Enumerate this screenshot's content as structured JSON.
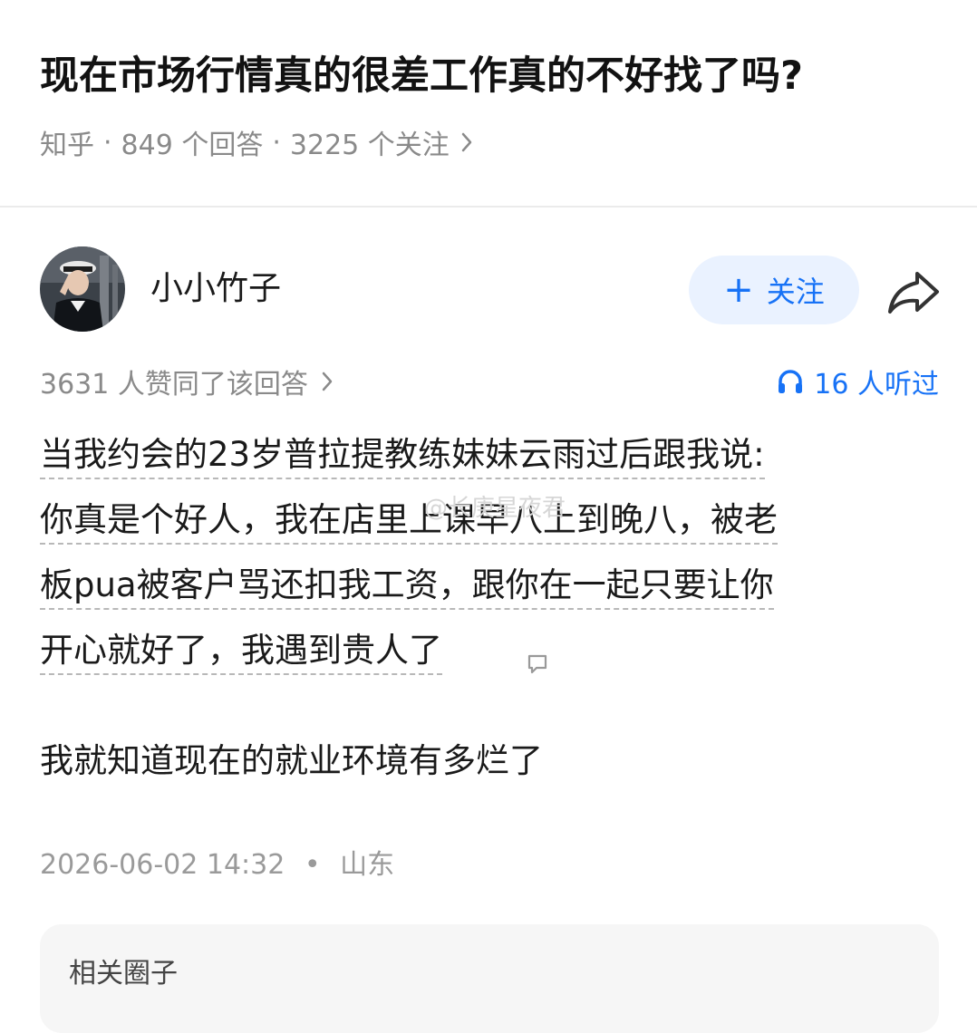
{
  "question": {
    "title": "现在市场行情真的很差工作真的不好找了吗?",
    "source": "知乎",
    "answers": "849 个回答",
    "follows": "3225 个关注"
  },
  "author": {
    "name": "小小竹子",
    "follow_label": "关注"
  },
  "stats": {
    "upvotes": "3631 人赞同了该回答",
    "listened": "16 人听过"
  },
  "answer": {
    "lines": [
      "当我约会的23岁普拉提教练妹妹云雨过后跟我说:",
      "你真是个好人，我在店里上课早八上到晚八，被老",
      "板pua被客户骂还扣我工资，跟你在一起只要让你",
      "开心就好了，我遇到贵人了"
    ],
    "conclusion": "我就知道现在的就业环境有多烂了",
    "watermark": "@长庚星夜君"
  },
  "footer": {
    "datetime": "2026-06-02 14:32",
    "location": "山东"
  },
  "related": {
    "title": "相关圈子"
  },
  "colors": {
    "accent": "#1772f6",
    "follow_bg": "#eaf2ff",
    "muted": "#8a8a8a"
  },
  "icons": [
    "chevron-right-icon",
    "plus-icon",
    "share-icon",
    "headphones-icon",
    "comment-icon"
  ]
}
